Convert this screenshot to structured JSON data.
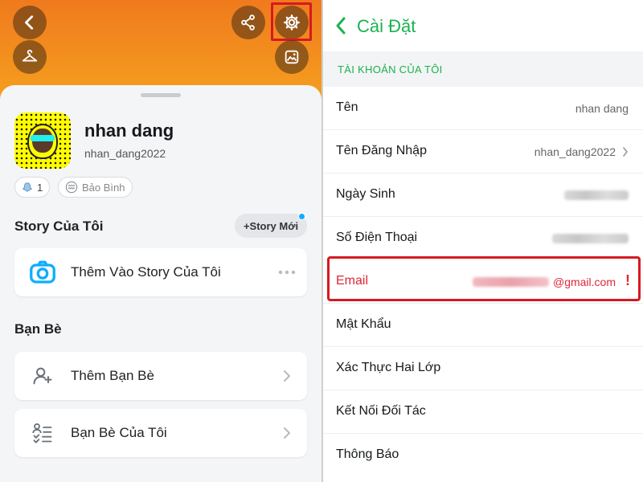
{
  "left": {
    "profile": {
      "name": "nhan dang",
      "username": "nhan_dang2022"
    },
    "badges": {
      "friends_count": "1",
      "zodiac": "Bảo Bình"
    },
    "story": {
      "title": "Story Của Tôi",
      "new_story_label": "+Story Mới",
      "add_to_story": "Thêm Vào Story Của Tôi"
    },
    "friends": {
      "title": "Bạn Bè",
      "add_friends": "Thêm Bạn Bè",
      "my_friends": "Bạn Bè Của Tôi"
    },
    "colors": {
      "header_orange": "#f07a1d",
      "highlight_red": "#d71920",
      "accent_blue": "#0fadff"
    }
  },
  "right": {
    "header": {
      "title": "Cài Đặt"
    },
    "section": {
      "label": "TÀI KHOẢN CỦA TÔI"
    },
    "rows": {
      "name": {
        "label": "Tên",
        "value": "nhan dang"
      },
      "username": {
        "label": "Tên Đăng Nhập",
        "value": "nhan_dang2022"
      },
      "birthday": {
        "label": "Ngày Sinh"
      },
      "phone": {
        "label": "Số Điện Thoại"
      },
      "email": {
        "label": "Email",
        "value": "@gmail.com"
      },
      "password": {
        "label": "Mật Khẩu"
      },
      "two_factor": {
        "label": "Xác Thực Hai Lớp"
      },
      "partners": {
        "label": "Kết Nối Đối Tác"
      },
      "notifications": {
        "label": "Thông Báo"
      }
    },
    "colors": {
      "accent_green": "#1bb24f",
      "error_red": "#e0263a"
    }
  }
}
